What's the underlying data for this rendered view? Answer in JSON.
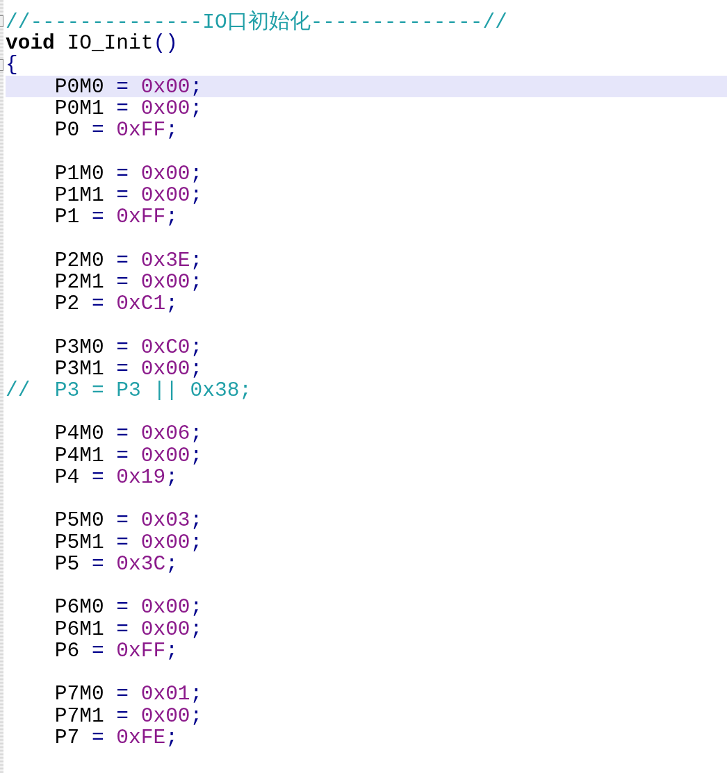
{
  "editor": {
    "lines": [
      {
        "current": false,
        "fold_marker": true,
        "tokens": [
          {
            "kind": "comment",
            "text": "//--------------IO口初始化--------------//"
          }
        ]
      },
      {
        "current": false,
        "fold_marker": false,
        "tokens": [
          {
            "kind": "keyword",
            "text": "void"
          },
          {
            "kind": "plain",
            "text": " IO_Init"
          },
          {
            "kind": "operator",
            "text": "()"
          }
        ]
      },
      {
        "current": false,
        "fold_marker": true,
        "tokens": [
          {
            "kind": "operator",
            "text": "{"
          }
        ]
      },
      {
        "current": true,
        "fold_marker": false,
        "tokens": [
          {
            "kind": "plain",
            "text": "    P0M0 "
          },
          {
            "kind": "operator",
            "text": "="
          },
          {
            "kind": "number",
            "text": " 0x00"
          },
          {
            "kind": "operator",
            "text": ";"
          }
        ]
      },
      {
        "current": false,
        "fold_marker": false,
        "tokens": [
          {
            "kind": "plain",
            "text": "    P0M1 "
          },
          {
            "kind": "operator",
            "text": "="
          },
          {
            "kind": "number",
            "text": " 0x00"
          },
          {
            "kind": "operator",
            "text": ";"
          }
        ]
      },
      {
        "current": false,
        "fold_marker": false,
        "tokens": [
          {
            "kind": "plain",
            "text": "    P0 "
          },
          {
            "kind": "operator",
            "text": "="
          },
          {
            "kind": "number",
            "text": " 0xFF"
          },
          {
            "kind": "operator",
            "text": ";"
          }
        ]
      },
      {
        "current": false,
        "fold_marker": false
      },
      {
        "current": false,
        "fold_marker": false,
        "tokens": [
          {
            "kind": "plain",
            "text": "    P1M0 "
          },
          {
            "kind": "operator",
            "text": "="
          },
          {
            "kind": "number",
            "text": " 0x00"
          },
          {
            "kind": "operator",
            "text": ";"
          }
        ]
      },
      {
        "current": false,
        "fold_marker": false,
        "tokens": [
          {
            "kind": "plain",
            "text": "    P1M1 "
          },
          {
            "kind": "operator",
            "text": "="
          },
          {
            "kind": "number",
            "text": " 0x00"
          },
          {
            "kind": "operator",
            "text": ";"
          }
        ]
      },
      {
        "current": false,
        "fold_marker": false,
        "tokens": [
          {
            "kind": "plain",
            "text": "    P1 "
          },
          {
            "kind": "operator",
            "text": "="
          },
          {
            "kind": "number",
            "text": " 0xFF"
          },
          {
            "kind": "operator",
            "text": ";"
          }
        ]
      },
      {
        "current": false,
        "fold_marker": false
      },
      {
        "current": false,
        "fold_marker": false,
        "tokens": [
          {
            "kind": "plain",
            "text": "    P2M0 "
          },
          {
            "kind": "operator",
            "text": "="
          },
          {
            "kind": "number",
            "text": " 0x3E"
          },
          {
            "kind": "operator",
            "text": ";"
          }
        ]
      },
      {
        "current": false,
        "fold_marker": false,
        "tokens": [
          {
            "kind": "plain",
            "text": "    P2M1 "
          },
          {
            "kind": "operator",
            "text": "="
          },
          {
            "kind": "number",
            "text": " 0x00"
          },
          {
            "kind": "operator",
            "text": ";"
          }
        ]
      },
      {
        "current": false,
        "fold_marker": false,
        "tokens": [
          {
            "kind": "plain",
            "text": "    P2 "
          },
          {
            "kind": "operator",
            "text": "="
          },
          {
            "kind": "number",
            "text": " 0xC1"
          },
          {
            "kind": "operator",
            "text": ";"
          }
        ]
      },
      {
        "current": false,
        "fold_marker": false
      },
      {
        "current": false,
        "fold_marker": false,
        "tokens": [
          {
            "kind": "plain",
            "text": "    P3M0 "
          },
          {
            "kind": "operator",
            "text": "="
          },
          {
            "kind": "number",
            "text": " 0xC0"
          },
          {
            "kind": "operator",
            "text": ";"
          }
        ]
      },
      {
        "current": false,
        "fold_marker": false,
        "tokens": [
          {
            "kind": "plain",
            "text": "    P3M1 "
          },
          {
            "kind": "operator",
            "text": "="
          },
          {
            "kind": "number",
            "text": " 0x00"
          },
          {
            "kind": "operator",
            "text": ";"
          }
        ]
      },
      {
        "current": false,
        "fold_marker": false,
        "tokens": [
          {
            "kind": "comment",
            "text": "//  P3 = P3 || 0x38;"
          }
        ]
      },
      {
        "current": false,
        "fold_marker": false
      },
      {
        "current": false,
        "fold_marker": false,
        "tokens": [
          {
            "kind": "plain",
            "text": "    P4M0 "
          },
          {
            "kind": "operator",
            "text": "="
          },
          {
            "kind": "number",
            "text": " 0x06"
          },
          {
            "kind": "operator",
            "text": ";"
          }
        ]
      },
      {
        "current": false,
        "fold_marker": false,
        "tokens": [
          {
            "kind": "plain",
            "text": "    P4M1 "
          },
          {
            "kind": "operator",
            "text": "="
          },
          {
            "kind": "number",
            "text": " 0x00"
          },
          {
            "kind": "operator",
            "text": ";"
          }
        ]
      },
      {
        "current": false,
        "fold_marker": false,
        "tokens": [
          {
            "kind": "plain",
            "text": "    P4 "
          },
          {
            "kind": "operator",
            "text": "="
          },
          {
            "kind": "number",
            "text": " 0x19"
          },
          {
            "kind": "operator",
            "text": ";"
          }
        ]
      },
      {
        "current": false,
        "fold_marker": false
      },
      {
        "current": false,
        "fold_marker": false,
        "tokens": [
          {
            "kind": "plain",
            "text": "    P5M0 "
          },
          {
            "kind": "operator",
            "text": "="
          },
          {
            "kind": "number",
            "text": " 0x03"
          },
          {
            "kind": "operator",
            "text": ";"
          }
        ]
      },
      {
        "current": false,
        "fold_marker": false,
        "tokens": [
          {
            "kind": "plain",
            "text": "    P5M1 "
          },
          {
            "kind": "operator",
            "text": "="
          },
          {
            "kind": "number",
            "text": " 0x00"
          },
          {
            "kind": "operator",
            "text": ";"
          }
        ]
      },
      {
        "current": false,
        "fold_marker": false,
        "tokens": [
          {
            "kind": "plain",
            "text": "    P5 "
          },
          {
            "kind": "operator",
            "text": "="
          },
          {
            "kind": "number",
            "text": " 0x3C"
          },
          {
            "kind": "operator",
            "text": ";"
          }
        ]
      },
      {
        "current": false,
        "fold_marker": false
      },
      {
        "current": false,
        "fold_marker": false,
        "tokens": [
          {
            "kind": "plain",
            "text": "    P6M0 "
          },
          {
            "kind": "operator",
            "text": "="
          },
          {
            "kind": "number",
            "text": " 0x00"
          },
          {
            "kind": "operator",
            "text": ";"
          }
        ]
      },
      {
        "current": false,
        "fold_marker": false,
        "tokens": [
          {
            "kind": "plain",
            "text": "    P6M1 "
          },
          {
            "kind": "operator",
            "text": "="
          },
          {
            "kind": "number",
            "text": " 0x00"
          },
          {
            "kind": "operator",
            "text": ";"
          }
        ]
      },
      {
        "current": false,
        "fold_marker": false,
        "tokens": [
          {
            "kind": "plain",
            "text": "    P6 "
          },
          {
            "kind": "operator",
            "text": "="
          },
          {
            "kind": "number",
            "text": " 0xFF"
          },
          {
            "kind": "operator",
            "text": ";"
          }
        ]
      },
      {
        "current": false,
        "fold_marker": false
      },
      {
        "current": false,
        "fold_marker": false,
        "tokens": [
          {
            "kind": "plain",
            "text": "    P7M0 "
          },
          {
            "kind": "operator",
            "text": "="
          },
          {
            "kind": "number",
            "text": " 0x01"
          },
          {
            "kind": "operator",
            "text": ";"
          }
        ]
      },
      {
        "current": false,
        "fold_marker": false,
        "tokens": [
          {
            "kind": "plain",
            "text": "    P7M1 "
          },
          {
            "kind": "operator",
            "text": "="
          },
          {
            "kind": "number",
            "text": " 0x00"
          },
          {
            "kind": "operator",
            "text": ";"
          }
        ]
      },
      {
        "current": false,
        "fold_marker": false,
        "tokens": [
          {
            "kind": "plain",
            "text": "    P7 "
          },
          {
            "kind": "operator",
            "text": "="
          },
          {
            "kind": "number",
            "text": " 0xFE"
          },
          {
            "kind": "operator",
            "text": ";"
          }
        ]
      }
    ]
  }
}
